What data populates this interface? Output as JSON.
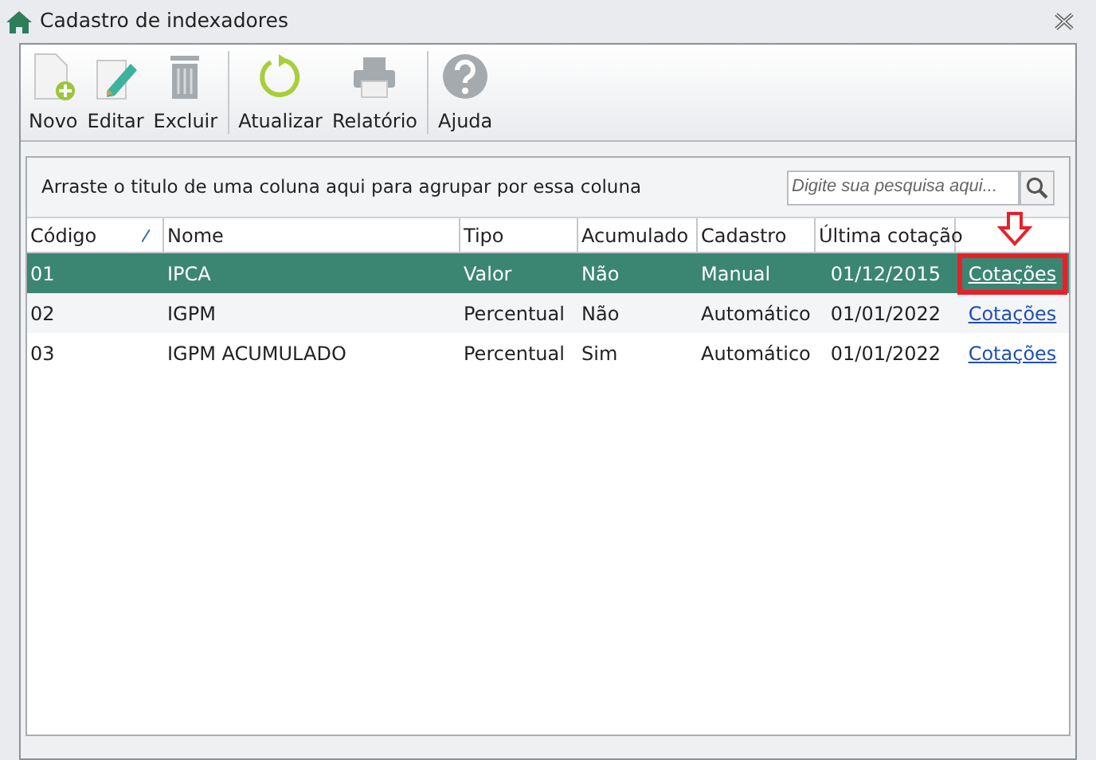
{
  "window": {
    "title": "Cadastro de indexadores"
  },
  "toolbar": [
    {
      "kind": "new",
      "label": "Novo",
      "disabled": false
    },
    {
      "kind": "edit",
      "label": "Editar",
      "disabled": false
    },
    {
      "kind": "delete",
      "label": "Excluir",
      "disabled": false
    },
    {
      "kind": "refresh",
      "label": "Atualizar",
      "disabled": false
    },
    {
      "kind": "print",
      "label": "Relatório",
      "disabled": false
    },
    {
      "kind": "help",
      "label": "Ajuda",
      "disabled": false
    }
  ],
  "group_panel": {
    "text": "Arraste o titulo de uma coluna aqui para agrupar por essa coluna"
  },
  "search": {
    "placeholder": "Digite sua pesquisa aqui..."
  },
  "table": {
    "columns": [
      {
        "label": "Código",
        "sorted": true
      },
      {
        "label": "Nome",
        "sorted": false
      },
      {
        "label": "Tipo",
        "sorted": false
      },
      {
        "label": "Acumulado",
        "sorted": false
      },
      {
        "label": "Cadastro",
        "sorted": false
      },
      {
        "label": "Última cotação",
        "sorted": false
      }
    ],
    "rows": [
      {
        "cells": [
          "01",
          "IPCA",
          "Valor",
          "Não",
          "Manual",
          "01/12/2015"
        ],
        "link": "Cotações",
        "selected": true,
        "annotated": true
      },
      {
        "cells": [
          "02",
          "IGPM",
          "Percentual",
          "Não",
          "Automático",
          "01/01/2022"
        ],
        "link": "Cotações",
        "selected": false,
        "annotated": false
      },
      {
        "cells": [
          "03",
          "IGPM ACUMULADO",
          "Percentual",
          "Sim",
          "Automático",
          "01/01/2022"
        ],
        "link": "Cotações",
        "selected": false,
        "annotated": false
      }
    ]
  }
}
